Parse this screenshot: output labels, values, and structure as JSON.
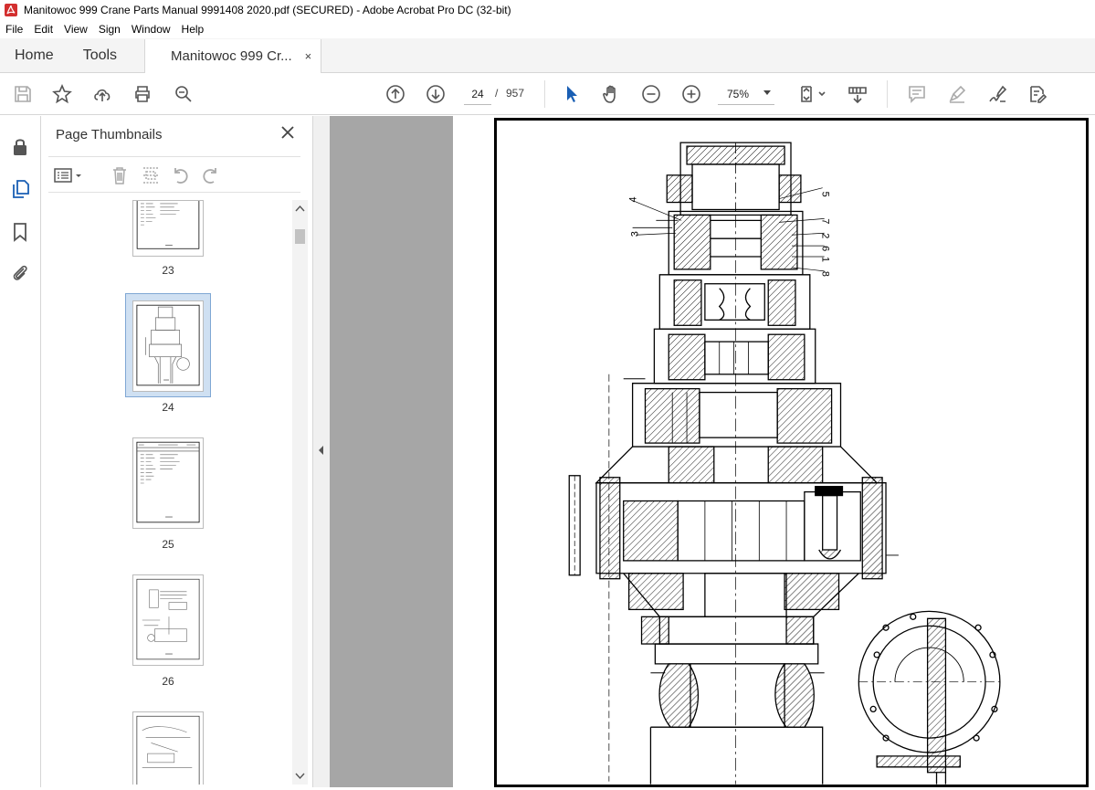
{
  "window": {
    "title": "Manitowoc 999 Crane Parts Manual 9991408 2020.pdf (SECURED) - Adobe Acrobat Pro DC (32-bit)"
  },
  "menu": [
    "File",
    "Edit",
    "View",
    "Sign",
    "Window",
    "Help"
  ],
  "tabs": {
    "home": "Home",
    "tools": "Tools",
    "document": "Manitowoc 999 Cr...",
    "close": "×"
  },
  "toolbar": {
    "current_page": "24",
    "page_separator": "/",
    "total_pages": "957",
    "zoom": "75%"
  },
  "panel": {
    "title": "Page Thumbnails",
    "close": "✕"
  },
  "thumbnails": [
    {
      "label": "23"
    },
    {
      "label": "24",
      "selected": true
    },
    {
      "label": "25"
    },
    {
      "label": "26"
    },
    {
      "label": ""
    }
  ],
  "drawing": {
    "callouts": [
      "4",
      "5",
      "3",
      "7",
      "2",
      "6",
      "1",
      "8"
    ]
  }
}
